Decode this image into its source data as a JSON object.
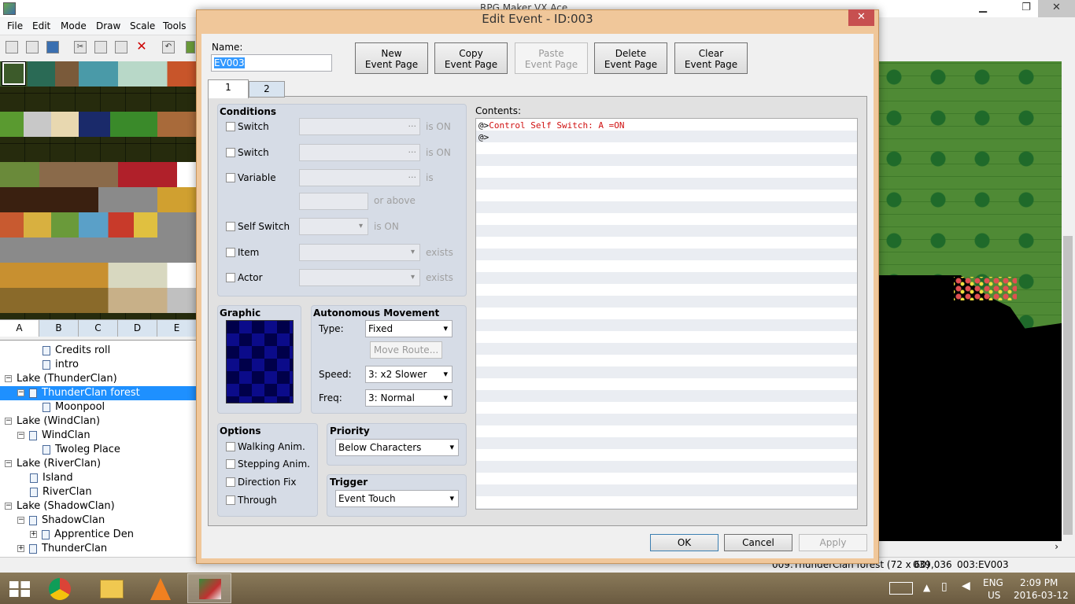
{
  "app": {
    "title": "RPG Maker VX Ace"
  },
  "menu": [
    "File",
    "Edit",
    "Mode",
    "Draw",
    "Scale",
    "Tools"
  ],
  "tileset_tabs": [
    "A",
    "B",
    "C",
    "D",
    "E"
  ],
  "map_tree": [
    {
      "label": "Credits roll",
      "level": 2
    },
    {
      "label": "intro",
      "level": 2
    },
    {
      "label": "Lake (ThunderClan)",
      "level": 0,
      "expander": "−"
    },
    {
      "label": "ThunderClan forest",
      "level": 1,
      "expander": "−",
      "selected": true
    },
    {
      "label": "Moonpool",
      "level": 2
    },
    {
      "label": "Lake (WindClan)",
      "level": 0,
      "expander": "−"
    },
    {
      "label": "WindClan",
      "level": 1,
      "expander": "−"
    },
    {
      "label": "Twoleg Place",
      "level": 2
    },
    {
      "label": "Lake (RiverClan)",
      "level": 0,
      "expander": "−"
    },
    {
      "label": "Island",
      "level": 1
    },
    {
      "label": "RiverClan",
      "level": 1
    },
    {
      "label": "Lake (ShadowClan)",
      "level": 0,
      "expander": "−"
    },
    {
      "label": "ShadowClan",
      "level": 1,
      "expander": "−"
    },
    {
      "label": "Apprentice Den",
      "level": 2,
      "expander": "+"
    },
    {
      "label": "ThunderClan",
      "level": 1,
      "expander": "+"
    }
  ],
  "status": {
    "map": "009:ThunderClan forest (72 x 60)",
    "coords": "039,036",
    "event": "003:EV003"
  },
  "taskbar": {
    "lang": "ENG",
    "region": "US",
    "time": "2:09 PM",
    "date": "2016-03-12"
  },
  "dialog": {
    "title": "Edit Event - ID:003",
    "close": "✕",
    "name_label": "Name:",
    "name_value": "EV003",
    "buttons": [
      {
        "line1": "New",
        "line2": "Event Page",
        "enabled": true
      },
      {
        "line1": "Copy",
        "line2": "Event Page",
        "enabled": true
      },
      {
        "line1": "Paste",
        "line2": "Event Page",
        "enabled": false
      },
      {
        "line1": "Delete",
        "line2": "Event Page",
        "enabled": true
      },
      {
        "line1": "Clear",
        "line2": "Event Page",
        "enabled": true
      }
    ],
    "page_tabs": [
      "1",
      "2"
    ],
    "conditions": {
      "title": "Conditions",
      "switch1": "Switch",
      "switch2": "Switch",
      "variable": "Variable",
      "self_switch": "Self Switch",
      "item": "Item",
      "actor": "Actor",
      "is_on": "is ON",
      "is": "is",
      "or_above": "or above",
      "exists": "exists",
      "dots": "..."
    },
    "graphic": {
      "title": "Graphic"
    },
    "movement": {
      "title": "Autonomous Movement",
      "type_label": "Type:",
      "type_value": "Fixed",
      "move_route": "Move Route...",
      "speed_label": "Speed:",
      "speed_value": "3: x2 Slower",
      "freq_label": "Freq:",
      "freq_value": "3: Normal"
    },
    "options": {
      "title": "Options",
      "walking": "Walking Anim.",
      "stepping": "Stepping Anim.",
      "direction": "Direction Fix",
      "through": "Through"
    },
    "priority": {
      "title": "Priority",
      "value": "Below Characters"
    },
    "trigger": {
      "title": "Trigger",
      "value": "Event Touch"
    },
    "contents": {
      "label": "Contents:",
      "lines": [
        {
          "prefix": "@>",
          "text": "Control Self Switch: A =ON"
        },
        {
          "prefix": "@>",
          "text": ""
        }
      ]
    },
    "footer": {
      "ok": "OK",
      "cancel": "Cancel",
      "apply": "Apply"
    }
  }
}
